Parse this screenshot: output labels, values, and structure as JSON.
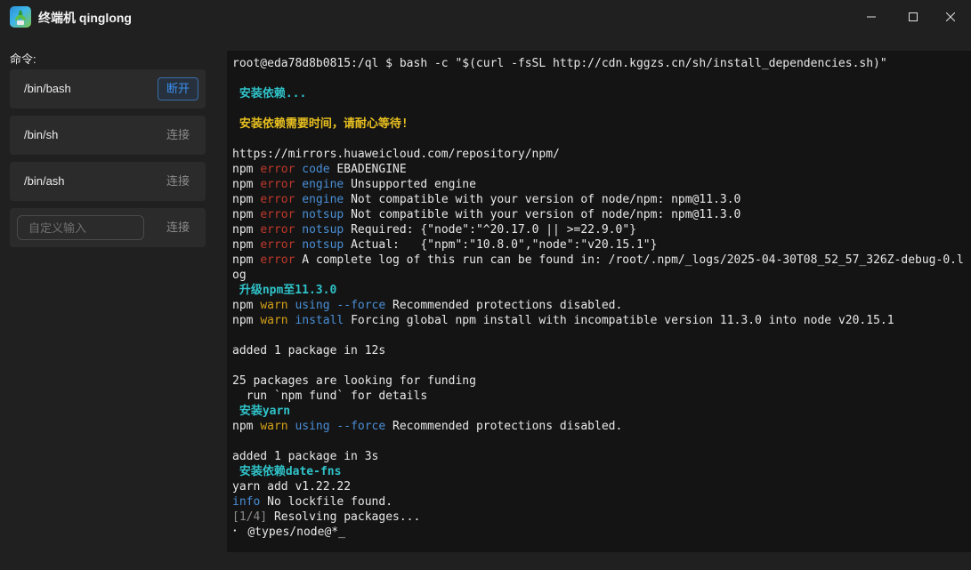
{
  "window": {
    "title": "终端机 qinglong",
    "icon": "qinglong-app-icon"
  },
  "sidebar": {
    "label": "命令:",
    "items": [
      {
        "name": "/bin/bash",
        "action": "断开",
        "active": true
      },
      {
        "name": "/bin/sh",
        "action": "连接",
        "active": false
      },
      {
        "name": "/bin/ash",
        "action": "连接",
        "active": false
      }
    ],
    "custom": {
      "placeholder": "自定义输入",
      "value": "",
      "action": "连接"
    }
  },
  "terminal": {
    "lines": [
      [
        {
          "t": "root@eda78d8b0815:/ql $ bash -c \"$(curl -fsSL http://cdn.kggzs.cn/sh/install_dependencies.sh)\"",
          "c": "white"
        }
      ],
      [],
      [
        {
          "t": " 安装依赖...",
          "c": "cyan"
        }
      ],
      [],
      [
        {
          "t": " 安装依赖需要时间，请耐心等待!",
          "c": "gold"
        }
      ],
      [],
      [
        {
          "t": "https://mirrors.huaweicloud.com/repository/npm/",
          "c": "white"
        }
      ],
      [
        {
          "t": "npm ",
          "c": "white"
        },
        {
          "t": "error",
          "c": "red"
        },
        {
          "t": " code",
          "c": "blue"
        },
        {
          "t": " EBADENGINE",
          "c": "white"
        }
      ],
      [
        {
          "t": "npm ",
          "c": "white"
        },
        {
          "t": "error",
          "c": "red"
        },
        {
          "t": " engine",
          "c": "blue"
        },
        {
          "t": " Unsupported engine",
          "c": "white"
        }
      ],
      [
        {
          "t": "npm ",
          "c": "white"
        },
        {
          "t": "error",
          "c": "red"
        },
        {
          "t": " engine",
          "c": "blue"
        },
        {
          "t": " Not compatible with your version of node/npm: npm@11.3.0",
          "c": "white"
        }
      ],
      [
        {
          "t": "npm ",
          "c": "white"
        },
        {
          "t": "error",
          "c": "red"
        },
        {
          "t": " notsup",
          "c": "blue"
        },
        {
          "t": " Not compatible with your version of node/npm: npm@11.3.0",
          "c": "white"
        }
      ],
      [
        {
          "t": "npm ",
          "c": "white"
        },
        {
          "t": "error",
          "c": "red"
        },
        {
          "t": " notsup",
          "c": "blue"
        },
        {
          "t": " Required: {\"node\":\"^20.17.0 || >=22.9.0\"}",
          "c": "white"
        }
      ],
      [
        {
          "t": "npm ",
          "c": "white"
        },
        {
          "t": "error",
          "c": "red"
        },
        {
          "t": " notsup",
          "c": "blue"
        },
        {
          "t": " Actual:   {\"npm\":\"10.8.0\",\"node\":\"v20.15.1\"}",
          "c": "white"
        }
      ],
      [
        {
          "t": "npm ",
          "c": "white"
        },
        {
          "t": "error",
          "c": "red"
        },
        {
          "t": " A complete log of this run can be found in: /root/.npm/_logs/2025-04-30T08_52_57_326Z-debug-0.l",
          "c": "white"
        }
      ],
      [
        {
          "t": "og",
          "c": "white"
        }
      ],
      [
        {
          "t": " 升级npm至11.3.0",
          "c": "cyan"
        }
      ],
      [
        {
          "t": "npm ",
          "c": "white"
        },
        {
          "t": "warn",
          "c": "yellow"
        },
        {
          "t": " using --force",
          "c": "blue"
        },
        {
          "t": " Recommended protections disabled.",
          "c": "white"
        }
      ],
      [
        {
          "t": "npm ",
          "c": "white"
        },
        {
          "t": "warn",
          "c": "yellow"
        },
        {
          "t": " install",
          "c": "blue"
        },
        {
          "t": " Forcing global npm install with incompatible version 11.3.0 into node v20.15.1",
          "c": "white"
        }
      ],
      [],
      [
        {
          "t": "added 1 package in 12s",
          "c": "white"
        }
      ],
      [],
      [
        {
          "t": "25 packages are looking for funding",
          "c": "white"
        }
      ],
      [
        {
          "t": "  run `npm fund` for details",
          "c": "white"
        }
      ],
      [
        {
          "t": " 安装yarn",
          "c": "cyan"
        }
      ],
      [
        {
          "t": "npm ",
          "c": "white"
        },
        {
          "t": "warn",
          "c": "yellow"
        },
        {
          "t": " using --force",
          "c": "blue"
        },
        {
          "t": " Recommended protections disabled.",
          "c": "white"
        }
      ],
      [],
      [
        {
          "t": "added 1 package in 3s",
          "c": "white"
        }
      ],
      [
        {
          "t": " 安装依赖date-fns",
          "c": "cyan"
        }
      ],
      [
        {
          "t": "yarn add v1.22.22",
          "c": "white"
        }
      ],
      [
        {
          "t": "info",
          "c": "blue"
        },
        {
          "t": " No lockfile found.",
          "c": "white"
        }
      ],
      [
        {
          "t": "[1/4]",
          "c": "gray"
        },
        {
          "t": " Resolving packages...",
          "c": "white"
        }
      ],
      [
        {
          "t": "⠂ @types/node@*_",
          "c": "white"
        }
      ]
    ]
  }
}
